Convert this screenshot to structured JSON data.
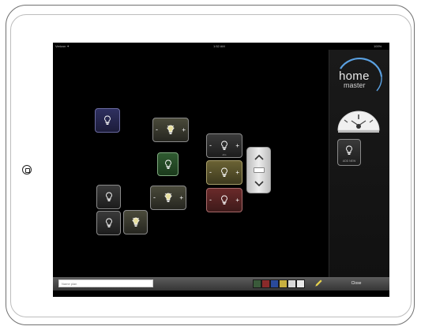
{
  "status_bar": {
    "carrier": "Verizon ✦",
    "time": "1:52 AM",
    "battery": "100%"
  },
  "sidebar": {
    "logo_word": "home",
    "logo_sub": "master",
    "device_label": "ADD NEW"
  },
  "tiles": {
    "control_minus": "-",
    "control_plus": "+",
    "small_label": "dim"
  },
  "bottom_bar": {
    "name_placeholder": "Name plan",
    "swatches": [
      "#3a5a3a",
      "#8a2a2a",
      "#2a4a9a",
      "#c8b040",
      "#d8d8d8",
      "#e8e8e8"
    ],
    "close_label": "Close"
  },
  "colors": {
    "screen": "#000000",
    "accent_blue": "#5aa0e0"
  }
}
